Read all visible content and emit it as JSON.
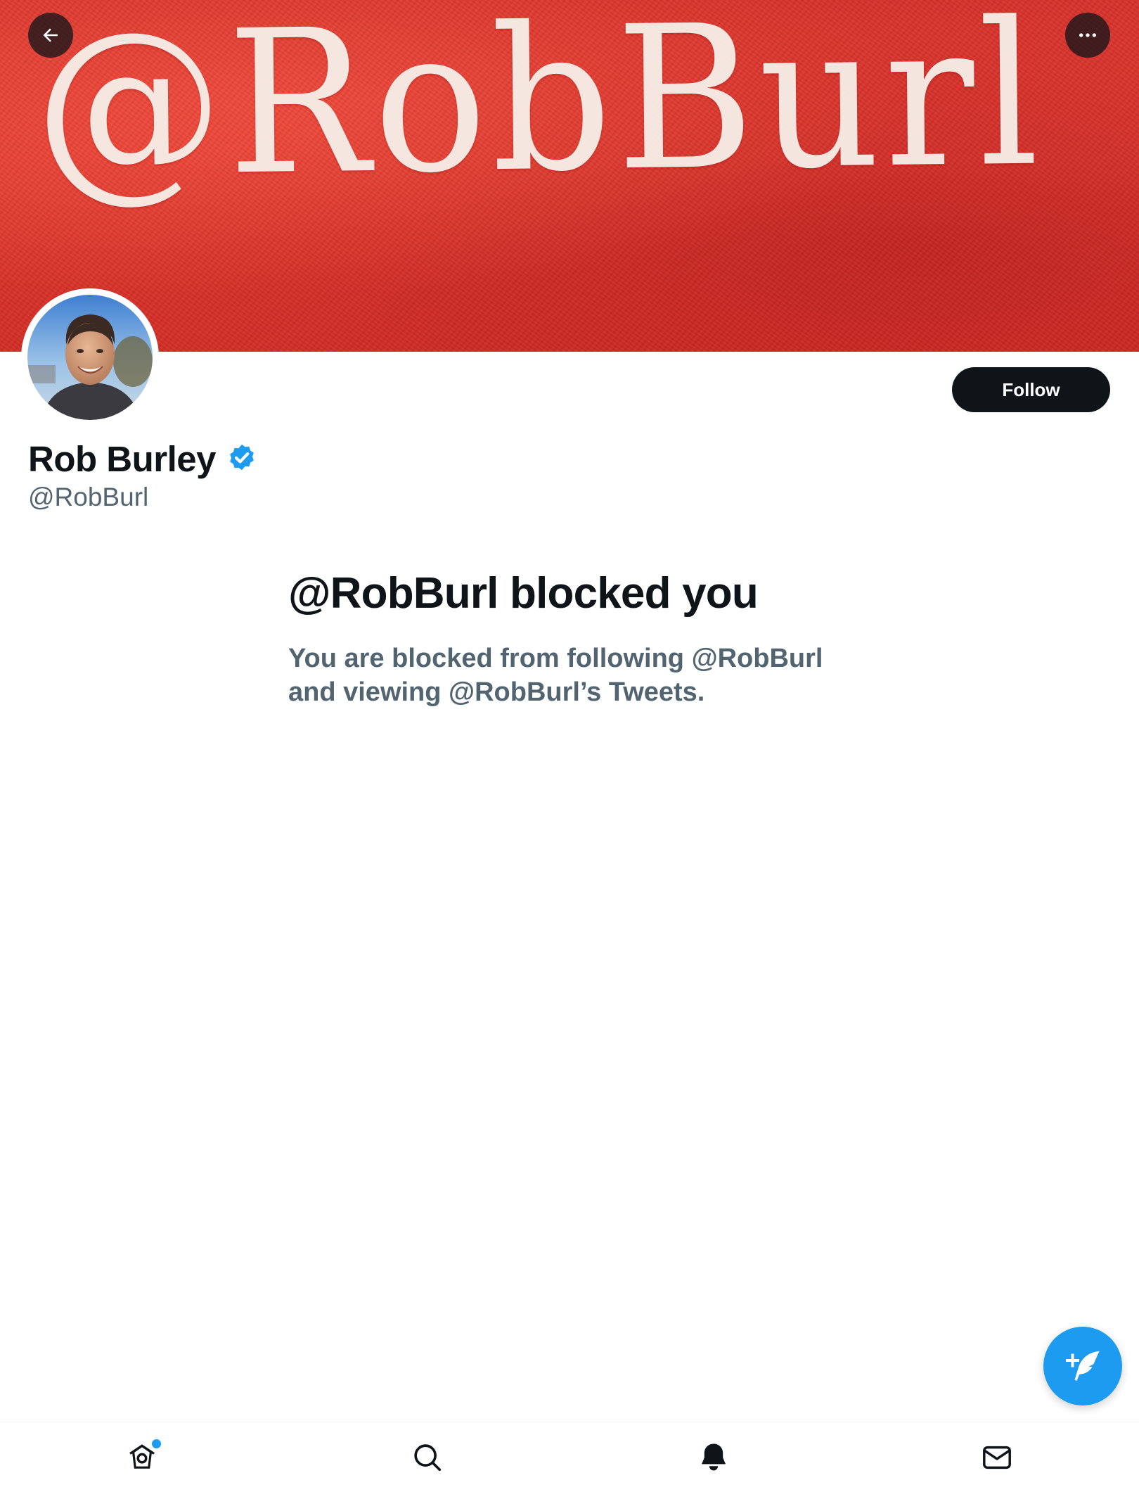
{
  "banner": {
    "wordmark": "@RobBurl",
    "colors": {
      "red": "#e2392f",
      "text": "#f7efe9"
    }
  },
  "header": {
    "back_icon": "arrow-left-icon",
    "more_icon": "more-horizontal-icon"
  },
  "profile": {
    "display_name": "Rob Burley",
    "handle": "@RobBurl",
    "verified": true,
    "verified_icon": "verified-badge-icon",
    "follow_label": "Follow"
  },
  "blocked": {
    "title": "@RobBurl blocked you",
    "description": "You are blocked from following @RobBurl and viewing @RobBurl’s Tweets."
  },
  "fab": {
    "icon": "compose-tweet-icon"
  },
  "bottom_nav": {
    "items": [
      {
        "name": "home",
        "icon": "home-icon",
        "has_badge": true
      },
      {
        "name": "search",
        "icon": "search-icon"
      },
      {
        "name": "notifications",
        "icon": "bell-icon",
        "active": true
      },
      {
        "name": "messages",
        "icon": "mail-icon"
      }
    ]
  },
  "colors": {
    "accent": "#1d9bf0",
    "text_primary": "#0f1419",
    "text_secondary": "#536471",
    "button_dark": "#0f1419"
  }
}
